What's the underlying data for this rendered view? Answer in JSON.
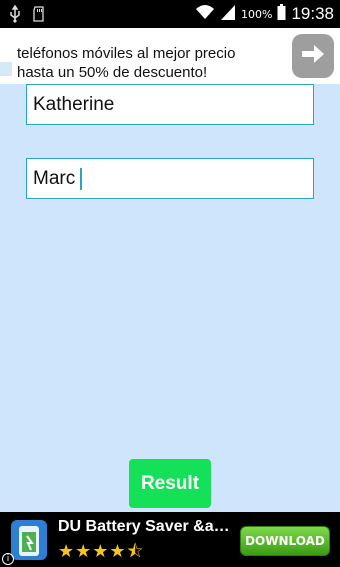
{
  "status_bar": {
    "icons_left": [
      "usb-icon",
      "sd-card-icon"
    ],
    "icons_right": [
      "wifi-icon",
      "signal-icon",
      "battery-icon"
    ],
    "battery_percent": "100%",
    "time": "19:38"
  },
  "top_ad": {
    "line1": "teléfonos móviles al mejor precio",
    "line2": "hasta un 50% de descuento!",
    "arrow_icon": "arrow-right-icon"
  },
  "form": {
    "input1_value": "Katherine",
    "input2_value": "Marc",
    "result_label": "Result"
  },
  "bottom_ad": {
    "app_title": "DU Battery Saver &a…",
    "stars": "★★★★⯪",
    "rating": 4.5,
    "download_label": "DOWNLOAD",
    "info_label": "i"
  },
  "colors": {
    "background": "#cfe5fb",
    "input_border": "#2aa3c4",
    "result_button": "#14e157",
    "download_button": "#4caf1f",
    "star": "#f5c518"
  }
}
